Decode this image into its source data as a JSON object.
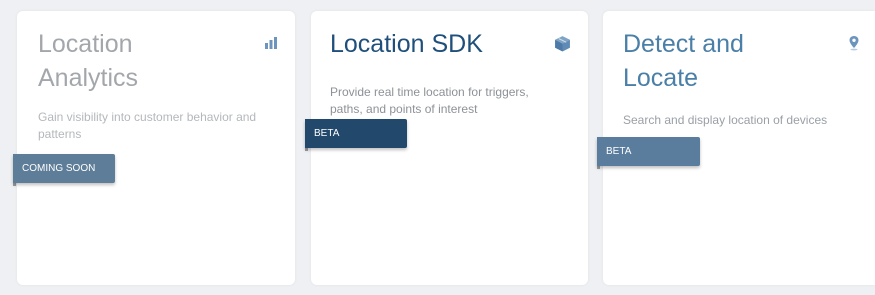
{
  "cards": [
    {
      "title": "Location Analytics",
      "icon": "bar-chart-icon",
      "description": "Gain visibility into customer behavior and patterns",
      "badge": "COMING SOON",
      "accent_color": "#a3a7ab",
      "badge_color": "#5e7d98"
    },
    {
      "title": "Location SDK",
      "icon": "cube-icon",
      "description": "Provide real time location for triggers, paths, and points of interest",
      "badge": "BETA",
      "accent_color": "#1f4f7b",
      "badge_color": "#22486c"
    },
    {
      "title": "Detect and Locate",
      "icon": "map-pin-icon",
      "description": "Search and display location of devices",
      "badge": "BETA",
      "accent_color": "#4a7fa8",
      "badge_color": "#5a7d9d"
    }
  ]
}
